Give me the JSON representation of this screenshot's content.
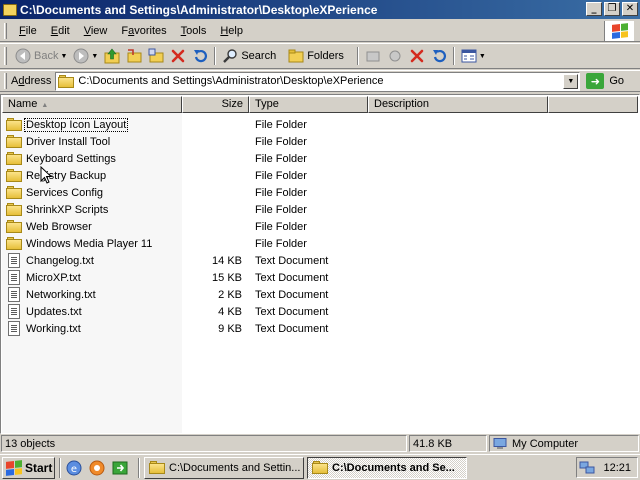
{
  "window": {
    "title": "C:\\Documents and Settings\\Administrator\\Desktop\\eXPerience",
    "minimize_icon": "minimize-icon",
    "maximize_icon": "restore-icon",
    "close_icon": "close-icon"
  },
  "menu": {
    "items": [
      {
        "accel": "F",
        "rest": "ile"
      },
      {
        "accel": "E",
        "rest": "dit"
      },
      {
        "accel": "V",
        "rest": "iew"
      },
      {
        "pre": "F",
        "accel": "a",
        "rest": "vorites"
      },
      {
        "accel": "T",
        "rest": "ools"
      },
      {
        "accel": "H",
        "rest": "elp"
      }
    ]
  },
  "toolbar": {
    "back_label": "Back",
    "search_label": "Search",
    "folders_label": "Folders"
  },
  "address": {
    "label": "Address",
    "accel": "d",
    "value": "C:\\Documents and Settings\\Administrator\\Desktop\\eXPerience",
    "go_label": "Go"
  },
  "columns": {
    "name": "Name",
    "size": "Size",
    "type": "Type",
    "description": "Description"
  },
  "files": [
    {
      "name": "Desktop Icon Layout",
      "size": "",
      "type": "File Folder",
      "kind": "folder"
    },
    {
      "name": "Driver Install Tool",
      "size": "",
      "type": "File Folder",
      "kind": "folder"
    },
    {
      "name": "Keyboard Settings",
      "size": "",
      "type": "File Folder",
      "kind": "folder"
    },
    {
      "name": "Registry Backup",
      "size": "",
      "type": "File Folder",
      "kind": "folder"
    },
    {
      "name": "Services Config",
      "size": "",
      "type": "File Folder",
      "kind": "folder"
    },
    {
      "name": "ShrinkXP Scripts",
      "size": "",
      "type": "File Folder",
      "kind": "folder"
    },
    {
      "name": "Web Browser",
      "size": "",
      "type": "File Folder",
      "kind": "folder"
    },
    {
      "name": "Windows Media Player 11",
      "size": "",
      "type": "File Folder",
      "kind": "folder"
    },
    {
      "name": "Changelog.txt",
      "size": "14 KB",
      "type": "Text Document",
      "kind": "text"
    },
    {
      "name": "MicroXP.txt",
      "size": "15 KB",
      "type": "Text Document",
      "kind": "text"
    },
    {
      "name": "Networking.txt",
      "size": "2 KB",
      "type": "Text Document",
      "kind": "text"
    },
    {
      "name": "Updates.txt",
      "size": "4 KB",
      "type": "Text Document",
      "kind": "text"
    },
    {
      "name": "Working.txt",
      "size": "9 KB",
      "type": "Text Document",
      "kind": "text"
    }
  ],
  "status": {
    "objects": "13 objects",
    "size": "41.8 KB",
    "zone": "My Computer"
  },
  "taskbar": {
    "start_label": "Start",
    "tasks": [
      {
        "label": "C:\\Documents and Settin...",
        "active": false
      },
      {
        "label": "C:\\Documents and Se...",
        "active": true
      }
    ],
    "clock": "12:21"
  },
  "colors": {
    "titlebar_start": "#0a246a",
    "titlebar_end": "#3a6ea5",
    "face": "#d4d0c8"
  }
}
